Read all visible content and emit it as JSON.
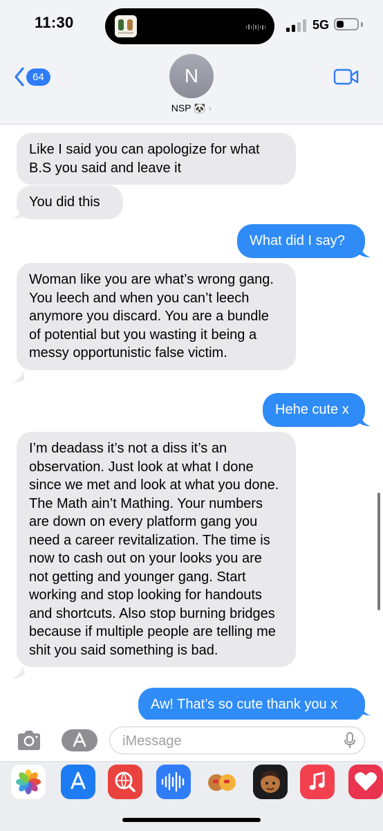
{
  "status": {
    "time": "11:30",
    "network": "5G",
    "battery_level": 0.35
  },
  "header": {
    "back_count": "64",
    "avatar_initial": "N",
    "contact_name": "NSP",
    "contact_emoji": "🐼",
    "chevron": "›"
  },
  "messages": [
    {
      "side": "in",
      "text": "Like I said you can apologize for what B.S you said and leave it"
    },
    {
      "side": "in",
      "text": "You did this"
    },
    {
      "side": "out",
      "text": "What did I say?"
    },
    {
      "side": "in",
      "text": "Woman like you are what’s wrong gang. You leech and when you can’t leech anymore you discard. You are a bundle of potential but you wasting it being a messy opportunistic false victim."
    },
    {
      "side": "out",
      "text": "Hehe cute x"
    },
    {
      "side": "in",
      "text": "I’m deadass it’s not a diss it’s an observation. Just look at what I done since we met and look at what you done. The Math ain’t Mathing. Your numbers are down on every platform gang you need a career revitalization. The time is now to cash out on your looks you are not getting and younger gang. Start working and stop looking for handouts and shortcuts. Also stop burning bridges because if multiple people are telling me shit you said something is bad."
    },
    {
      "side": "out",
      "text": "Aw! That’s so cute thank you x"
    }
  ],
  "input": {
    "placeholder": "iMessage"
  },
  "app_drawer": [
    "photos-app",
    "app-store",
    "images-search",
    "audio-message",
    "stickers",
    "memoji",
    "music",
    "digital-touch"
  ],
  "colors": {
    "bubble_in": "#e9e9eb",
    "bubble_out": "#2f8cf7",
    "accent": "#2f7cf6",
    "nav_bg": "#f2f3f6"
  }
}
